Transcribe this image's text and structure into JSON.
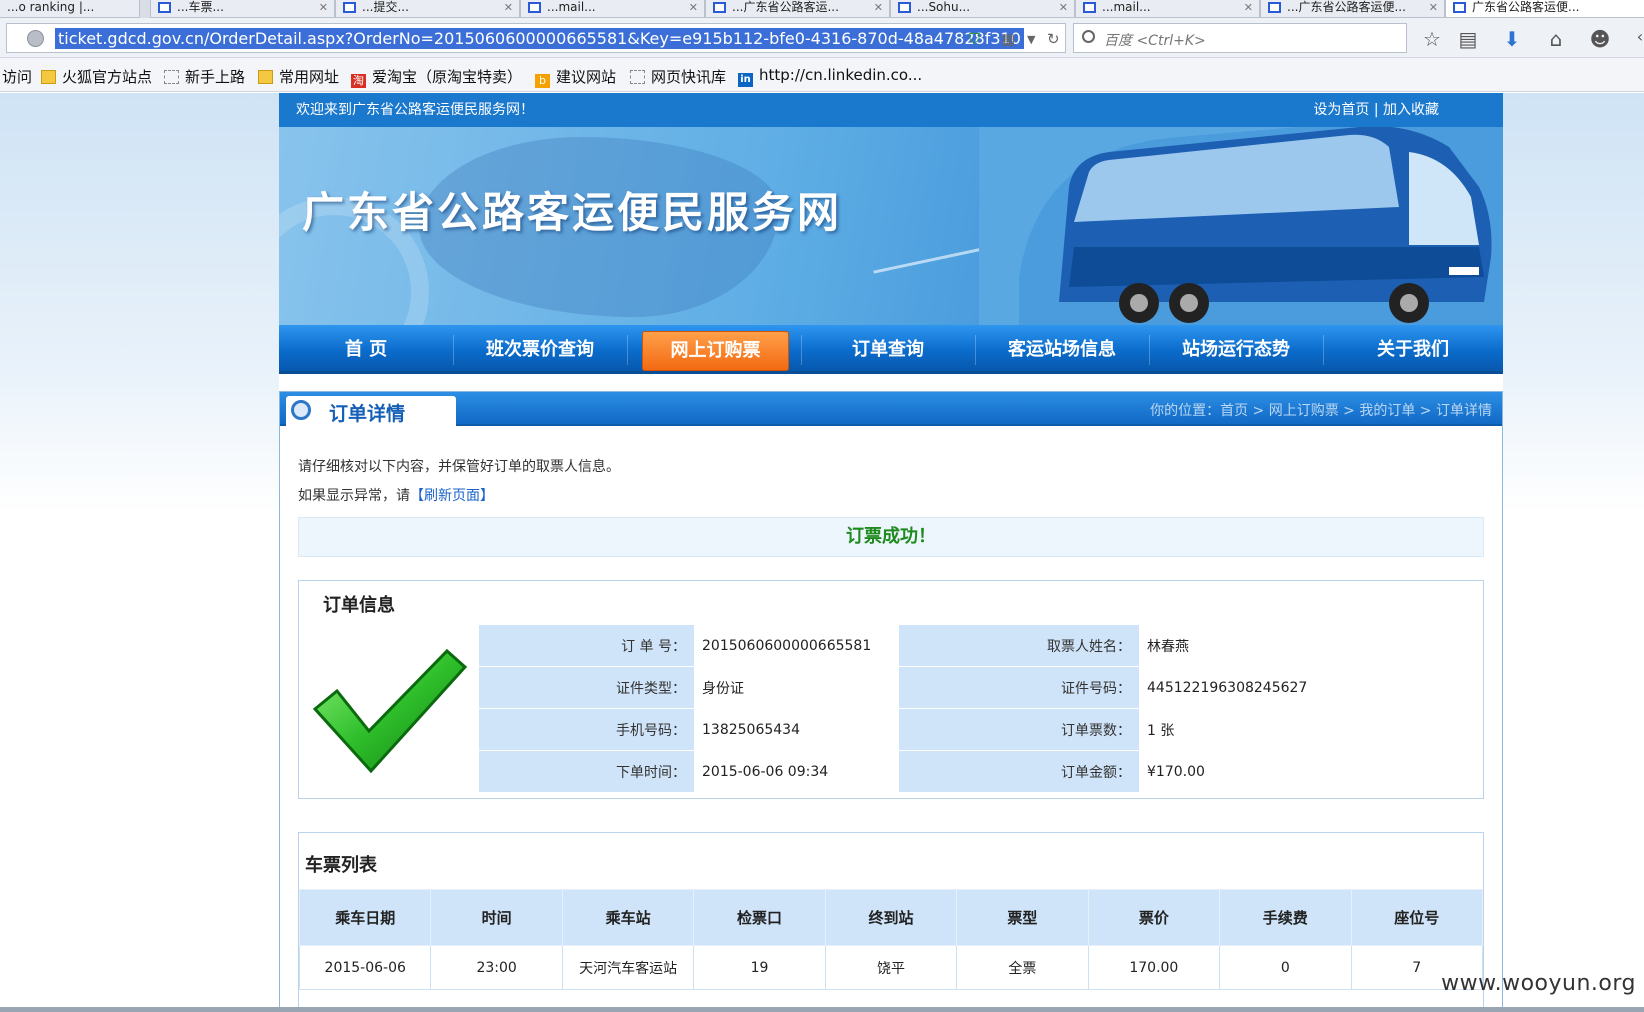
{
  "browser": {
    "tabs": [
      {
        "label": "...o ranking |..."
      },
      {
        "label": "...车票..."
      },
      {
        "label": "...提交..."
      },
      {
        "label": "...mail..."
      },
      {
        "label": "...广东省公路客运..."
      },
      {
        "label": "...Sohu..."
      },
      {
        "label": "...mail..."
      },
      {
        "label": "...广东省公路客运便..."
      },
      {
        "label": "广东省公路客运便..."
      }
    ],
    "url": "ticket.gdcd.gov.cn/OrderDetail.aspx?OrderNo=2015060600000665581&Key=e915b112-bfe0-4316-870d-48a47828f310",
    "search_placeholder": "百度 <Ctrl+K>",
    "bookmarks": [
      {
        "label": "访问",
        "icon": "none"
      },
      {
        "label": "火狐官方站点",
        "icon": "folder-icon"
      },
      {
        "label": "新手上路",
        "icon": "page-icon"
      },
      {
        "label": "常用网址",
        "icon": "folder-icon"
      },
      {
        "label": "爱淘宝（原淘宝特卖）",
        "icon": "taobao-icon"
      },
      {
        "label": "建议网站",
        "icon": "bing-icon"
      },
      {
        "label": "网页快讯库",
        "icon": "page-icon"
      },
      {
        "label": "http://cn.linkedin.co...",
        "icon": "linkedin-icon"
      }
    ]
  },
  "site": {
    "welcome": "欢迎来到广东省公路客运便民服务网！",
    "set_home": "设为首页",
    "separator": "|",
    "add_favorite": "加入收藏",
    "title": "广东省公路客运便民服务网",
    "nav": [
      {
        "label": "首 页",
        "active": false
      },
      {
        "label": "班次票价查询",
        "active": false
      },
      {
        "label": "网上订购票",
        "active": true
      },
      {
        "label": "订单查询",
        "active": false
      },
      {
        "label": "客运站场信息",
        "active": false
      },
      {
        "label": "站场运行态势",
        "active": false
      },
      {
        "label": "关于我们",
        "active": false
      }
    ]
  },
  "panel": {
    "title": "订单详情",
    "breadcrumb": "你的位置：首页 > 网上订购票 > 我的订单 > 订单详情",
    "notice_line1": "请仔细核对以下内容，并保管好订单的取票人信息。",
    "notice_line2_prefix": "如果显示异常，请",
    "refresh_link": "【刷新页面】",
    "success_message": "订票成功！"
  },
  "order_info": {
    "heading": "订单信息",
    "rows": [
      {
        "label1": "订 单 号：",
        "value1": "2015060600000665581",
        "label2": "取票人姓名：",
        "value2": "林春燕"
      },
      {
        "label1": "证件类型：",
        "value1": "身份证",
        "label2": "证件号码：",
        "value2": "445122196308245627"
      },
      {
        "label1": "手机号码：",
        "value1": "13825065434",
        "label2": "订单票数：",
        "value2": "1 张"
      },
      {
        "label1": "下单时间：",
        "value1": "2015-06-06 09:34",
        "label2": "订单金额：",
        "value2": "¥170.00"
      }
    ]
  },
  "ticket_list": {
    "heading": "车票列表",
    "columns": [
      "乘车日期",
      "时间",
      "乘车站",
      "检票口",
      "终到站",
      "票型",
      "票价",
      "手续费",
      "座位号"
    ],
    "rows": [
      [
        "2015-06-06",
        "23:00",
        "天河汽车客运站",
        "19",
        "饶平",
        "全票",
        "170.00",
        "0",
        "7"
      ]
    ]
  },
  "watermark": "www.wooyun.org",
  "colors": {
    "brand_blue": "#1a78cd",
    "nav_active": "#f36a12",
    "success_green": "#1e8a1e",
    "label_bg": "#cfe4f8"
  }
}
